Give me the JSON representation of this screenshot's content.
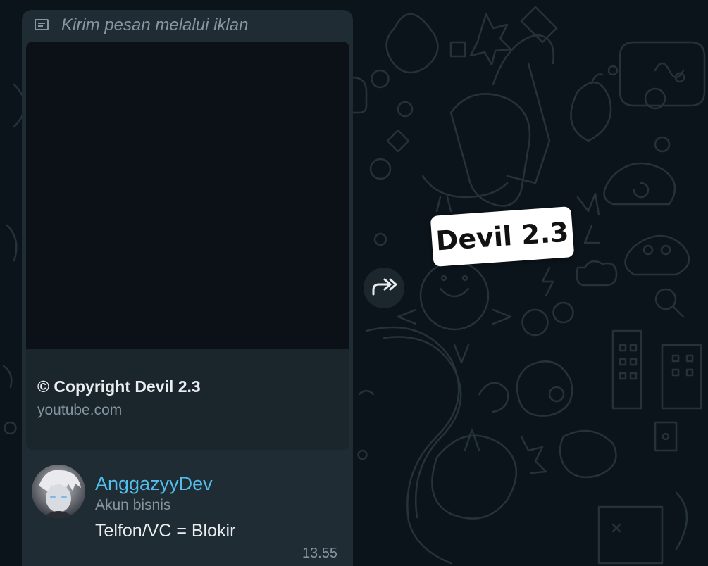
{
  "colors": {
    "chat_background": "#0b141a",
    "bubble_background": "#1f2c34",
    "link_preview_background": "#1a252c",
    "sender_name": "#53bdeb",
    "secondary_text": "#8696a0",
    "primary_text": "#e9edef",
    "sticker_background": "#ffffff"
  },
  "message": {
    "ad_header": {
      "icon": "ad-message-icon",
      "label": "Kirim pesan melalui iklan"
    },
    "link_preview": {
      "title": "© Copyright Devil 2.3",
      "domain": "youtube.com"
    },
    "sender": {
      "name": "AnggazyyDev",
      "subtitle": "Akun bisnis",
      "avatar": "avatar-image"
    },
    "text": "Telfon/VC = Blokir",
    "time": "13.55"
  },
  "forward": {
    "icon": "forward-icon"
  },
  "sticker": {
    "text": "Devil 2.3"
  }
}
